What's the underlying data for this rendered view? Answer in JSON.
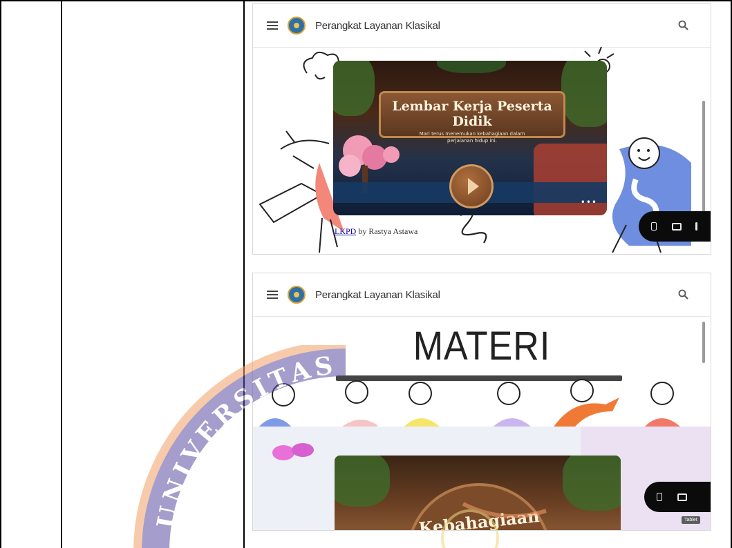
{
  "screenshot_top": {
    "site_title": "Perangkat Layanan Klasikal",
    "video_title": "Lembar Kerja Peserta Didik",
    "video_subtitle": "Mari terus menemukan kebahagiaan dalam perjalanan hidup ini.",
    "more_label": "•••",
    "credit_link": "LKPD",
    "credit_text": " by Rastya Astawa"
  },
  "screenshot_bottom": {
    "site_title": "Perangkat Layanan Klasikal",
    "heading": "MATERI",
    "video_title": "Kebahagiaan",
    "tooltip": "Tablet"
  },
  "watermark": {
    "text": "UNIVERSITAS",
    "colors": {
      "orange": "#f4a06a",
      "purple": "#5d4fa3"
    }
  },
  "icons": [
    "menu-icon",
    "logo-icon",
    "search-icon",
    "play-icon",
    "phone-icon",
    "tablet-icon"
  ]
}
